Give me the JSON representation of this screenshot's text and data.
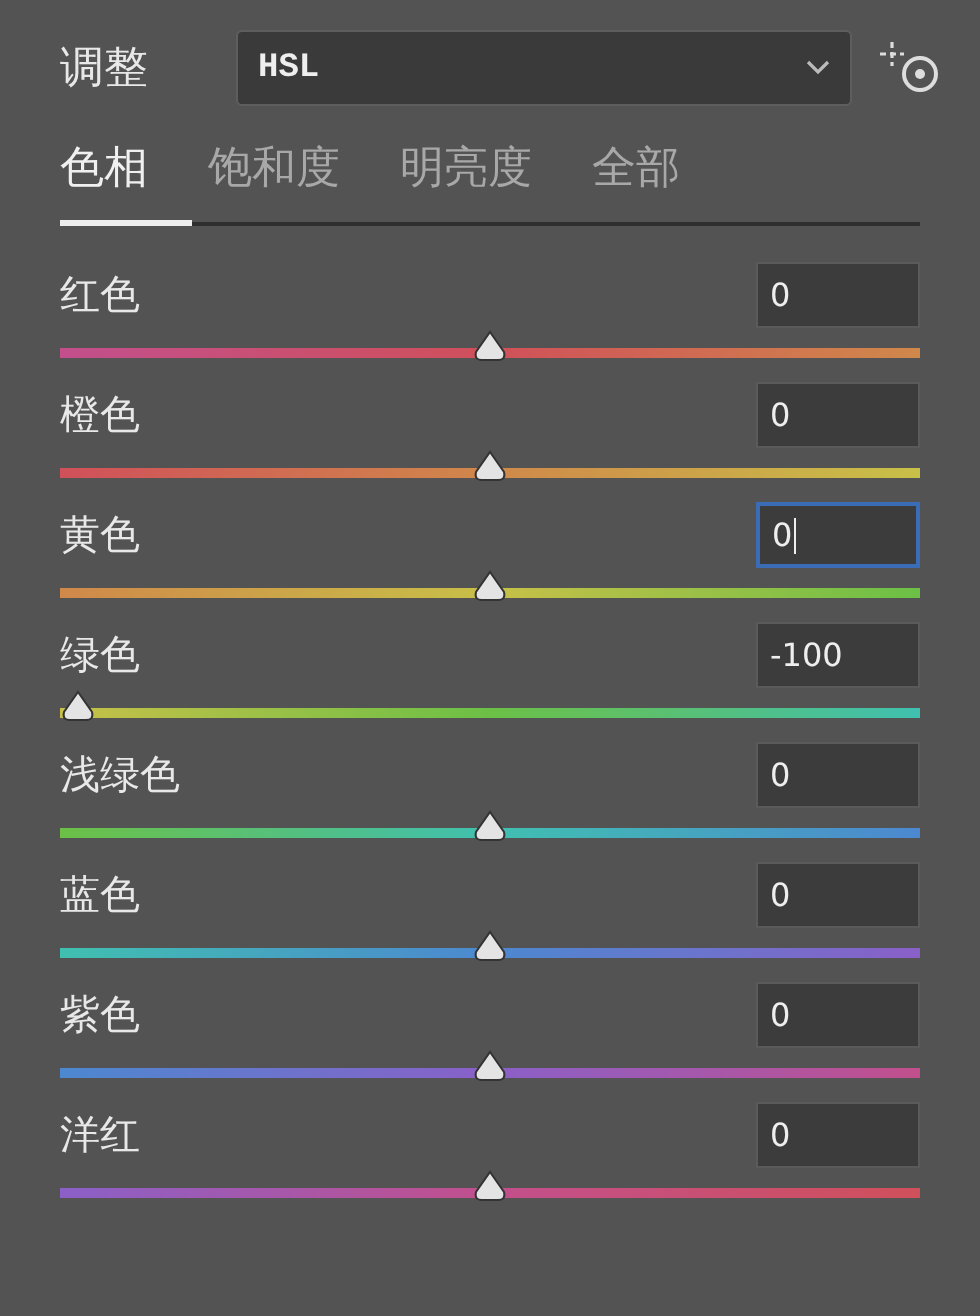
{
  "header": {
    "label": "调整",
    "dropdown": {
      "value": "HSL"
    }
  },
  "tabs": [
    {
      "label": "色相",
      "selected": true
    },
    {
      "label": "饱和度",
      "selected": false
    },
    {
      "label": "明亮度",
      "selected": false
    },
    {
      "label": "全部",
      "selected": false
    }
  ],
  "sliders": [
    {
      "label": "红色",
      "value": "0",
      "focused": false,
      "level": 0.5,
      "color": "#d0505a"
    },
    {
      "label": "橙色",
      "value": "0",
      "focused": false,
      "level": 0.5,
      "color": "#d0884a"
    },
    {
      "label": "黄色",
      "value": "0",
      "focused": true,
      "level": 0.5,
      "color": "#c8c048"
    },
    {
      "label": "绿色",
      "value": "-100",
      "focused": false,
      "level": 0,
      "color": "#6cc046"
    },
    {
      "label": "浅绿色",
      "value": "0",
      "focused": false,
      "level": 0.5,
      "color": "#40c0b0"
    },
    {
      "label": "蓝色",
      "value": "0",
      "focused": false,
      "level": 0.5,
      "color": "#4c88d0"
    },
    {
      "label": "紫色",
      "value": "0",
      "focused": false,
      "level": 0.5,
      "color": "#8a60c8"
    },
    {
      "label": "洋红",
      "value": "0",
      "focused": false,
      "level": 0.5,
      "color": "#c24f8c"
    }
  ]
}
